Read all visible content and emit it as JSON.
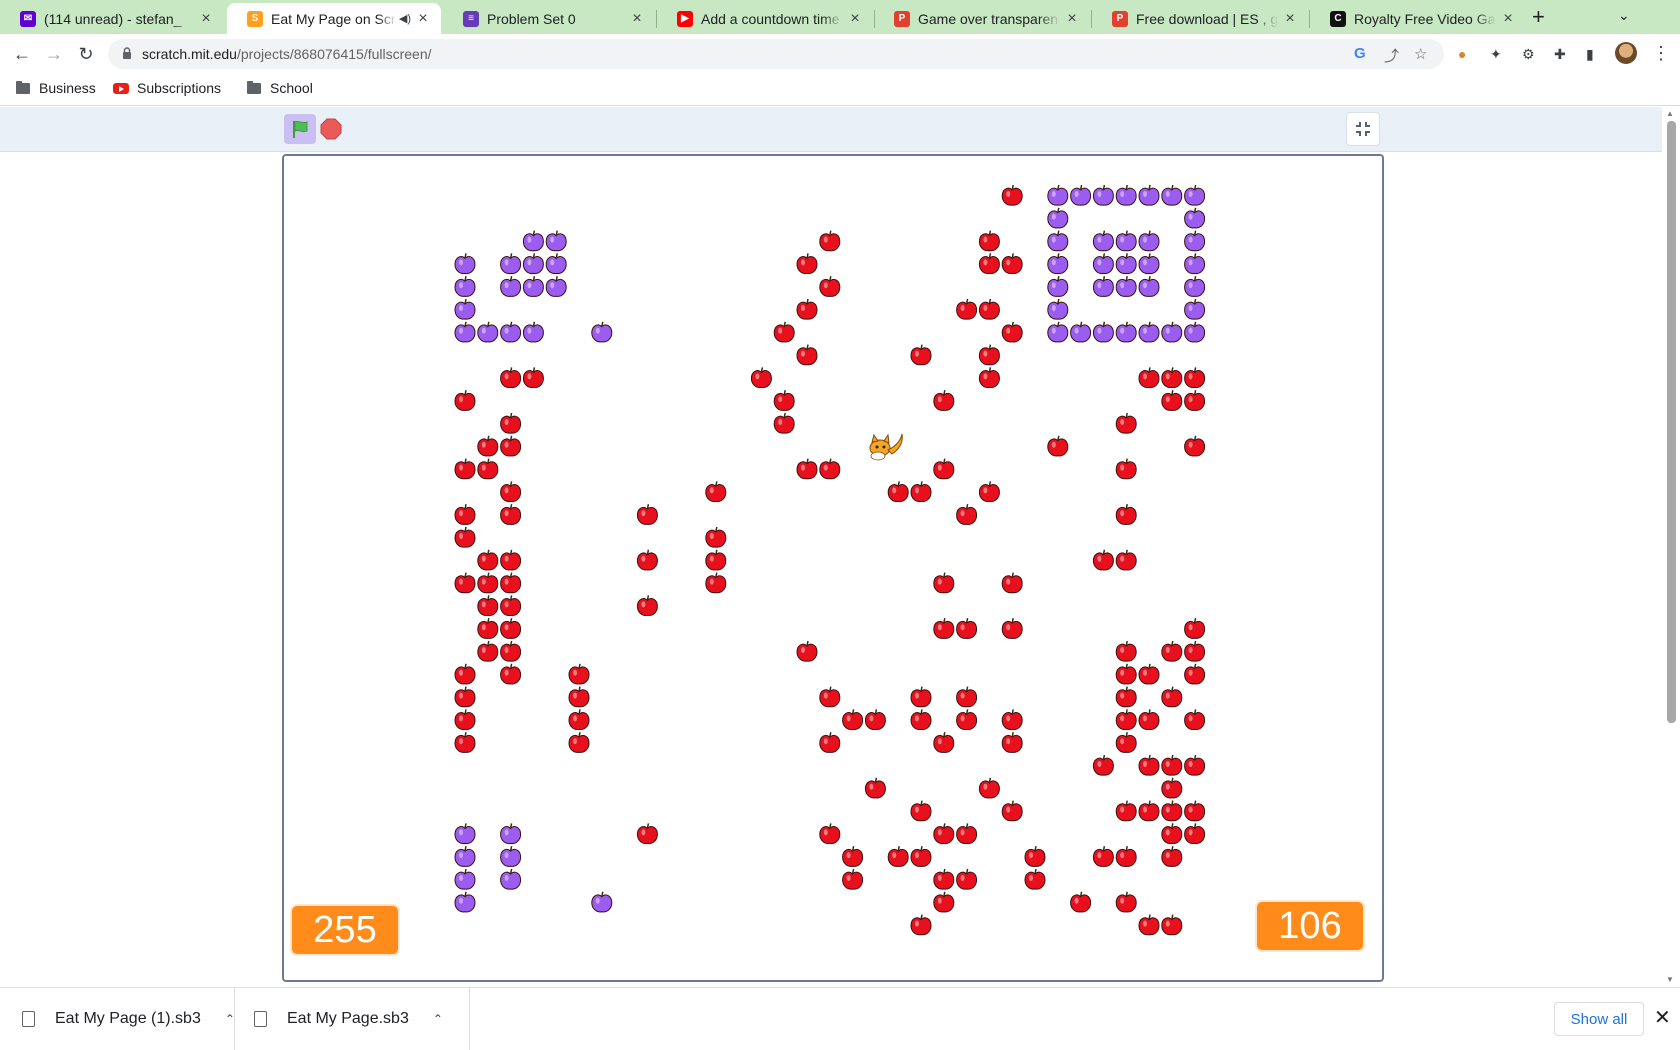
{
  "browser": {
    "tabs": [
      {
        "title": "(114 unread) - stefan_",
        "favicon": "yahoo-mail-icon",
        "color": "#6001d2"
      },
      {
        "title": "Eat My Page on Scr",
        "favicon": "scratch-icon",
        "color": "#ff9f1a",
        "active": true,
        "audio": true
      },
      {
        "title": "Problem Set 0",
        "favicon": "document-icon",
        "color": "#673ab7"
      },
      {
        "title": "Add a countdown time",
        "favicon": "youtube-icon",
        "color": "#ff0000"
      },
      {
        "title": "Game over transparen",
        "favicon": "image-site-icon",
        "color": "#e2402c"
      },
      {
        "title": "Free download | ES , g",
        "favicon": "image-site-icon",
        "color": "#e2402c"
      },
      {
        "title": "Royalty Free Video Gar",
        "favicon": "bold-c-icon",
        "color": "#111111"
      }
    ],
    "url_domain": "scratch.mit.edu",
    "url_path": "/projects/868076415/fullscreen/",
    "bookmarks": [
      {
        "label": "Business",
        "icon": "folder-icon"
      },
      {
        "label": "Subscriptions",
        "icon": "youtube-icon"
      },
      {
        "label": "School",
        "icon": "folder-icon"
      }
    ]
  },
  "stage": {
    "score_left": "255",
    "score_right": "106",
    "colors": {
      "apple_red": "#e8101c",
      "plum_purple": "#9b5cf0",
      "counter": "#ff8c1a"
    }
  },
  "downloads": {
    "items": [
      {
        "name": "Eat My Page (1).sb3"
      },
      {
        "name": "Eat My Page.sb3"
      }
    ],
    "show_all": "Show all"
  }
}
